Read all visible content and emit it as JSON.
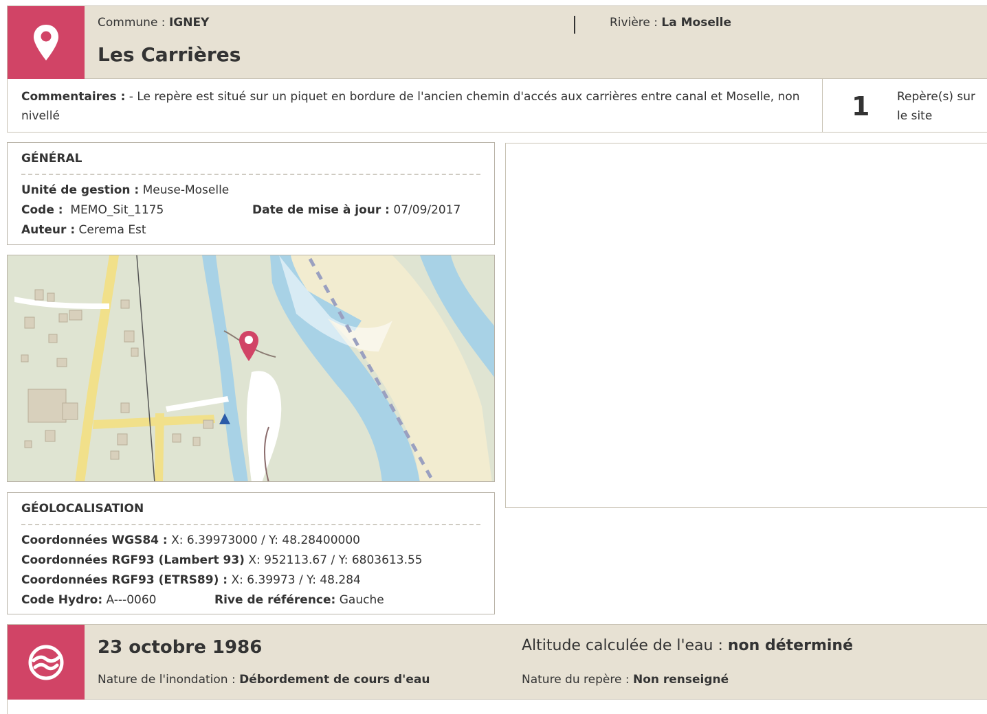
{
  "header": {
    "commune_label": "Commune : ",
    "commune_value": "IGNEY",
    "riviere_label": "Rivière : ",
    "riviere_value": "La Moselle",
    "title": "Les Carrières"
  },
  "comments": {
    "label": "Commentaires :",
    "text": " - Le repère est situé sur un piquet en bordure de l'ancien chemin d'accés aux carrières entre canal et Moselle, non nivellé",
    "count": "1",
    "count_label": "Repère(s) sur le site"
  },
  "general": {
    "title": "GÉNÉRAL",
    "unite_label": "Unité de gestion :",
    "unite_value": " Meuse-Moselle",
    "code_label": "Code :",
    "code_value": "  MEMO_Sit_1175",
    "date_label": "Date de mise à jour :",
    "date_value": " 07/09/2017",
    "auteur_label": "Auteur :",
    "auteur_value": " Cerema Est"
  },
  "geo": {
    "title": "GÉOLOCALISATION",
    "wgs_label": "Coordonnées WGS84 :",
    "wgs_value": " X: 6.39973000 / Y: 48.28400000",
    "lambert_label": "Coordonnées RGF93 (Lambert 93)",
    "lambert_value": " X: 952113.67 / Y: 6803613.55",
    "etrs_label": "Coordonnées RGF93 (ETRS89) :",
    "etrs_value": " X: 6.39973 / Y: 48.284",
    "hydro_label": "Code Hydro:",
    "hydro_value": " A---0060",
    "rive_label": "Rive de référence:",
    "rive_value": " Gauche"
  },
  "event": {
    "date": "23 octobre 1986",
    "nature_inond_label": "Nature de l'inondation : ",
    "nature_inond_value": "Débordement de cours d'eau",
    "altitude_label": "Altitude calculée de l'eau : ",
    "altitude_value": "non déterminé",
    "nature_rep_label": "Nature du repère : ",
    "nature_rep_value": "Non renseigné"
  },
  "colors": {
    "accent": "#d14466",
    "header_bg": "#e7e1d3",
    "water": "#a8d2e6",
    "sand": "#f2ecd0",
    "land": "#dfe4d2"
  },
  "icons": {
    "site": "map-pin-icon",
    "event": "flood-wave-icon",
    "map_marker": "map-pin-icon"
  }
}
